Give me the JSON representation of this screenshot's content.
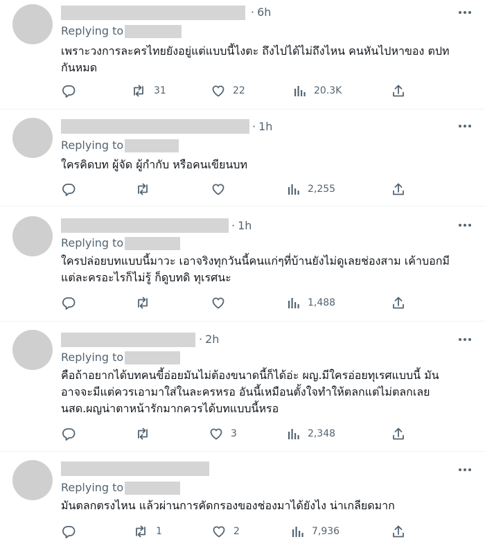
{
  "colors": {
    "meta_text": "#536471",
    "body_text": "#0f1419",
    "placeholder_gray": "#d5d5d5",
    "avatar_gray": "#cfcfcf",
    "divider": "#eff3f4"
  },
  "icons": {
    "reply": "comment-bubble-icon",
    "retweet": "retweet-arrows-icon",
    "like": "heart-icon",
    "views": "bar-chart-icon",
    "share": "upload-arrow-icon",
    "more": "more-dots-icon"
  },
  "tweets": [
    {
      "time": "6h",
      "replying_to": "Replying to",
      "text": "เพราะวงการละครไทยยังอยู่แต่แบบนี้ไงตะ ถึงไปได้ไม่ถึงไหน คนหันไปหาของ ตปท\nกันหมด",
      "replies": "",
      "retweets": "31",
      "likes": "22",
      "views": "20.3K"
    },
    {
      "time": "1h",
      "replying_to": "Replying to",
      "text": "ใครคิดบท ผู้จัด ผู้กำกับ หรือคนเขียนบท",
      "replies": "",
      "retweets": "",
      "likes": "",
      "views": "2,255"
    },
    {
      "time": "1h",
      "replying_to": "Replying to",
      "text": "ใครปล่อยบทแบบนี้มาวะ เอาจริงทุกวันนี้คนแก่ๆที่บ้านยังไม่ดูเลยช่องสาม เค้าบอกมี\nแต่ละครอะไรก็ไม่รู้ ก็ดูบทดิ ทุเรศนะ",
      "replies": "",
      "retweets": "",
      "likes": "",
      "views": "1,488"
    },
    {
      "time": "2h",
      "replying_to": "Replying to",
      "text": "คือถ้าอยากได้บทคนขี้อ่อยมันไม่ต้องขนาดนี้ก็ได้อ่ะ ผญ.มีใครอ่อยทุเรศแบบนี้ มัน\nอาจจะมีแต่ควรเอามาใส่ในละครหรอ อันนี้เหมือนตั้งใจทำให้ตลกแต่ไม่ตลกเลย\nนสด.ผญน่าตาหน้ารักมากควรได้บทแบบนี้หรอ",
      "replies": "",
      "retweets": "",
      "likes": "3",
      "views": "2,348"
    },
    {
      "time": "",
      "replying_to": "Replying to",
      "text": "มันตลกตรงไหน แล้วผ่านการคัดกรองของช่องมาได้ยังไง น่าเกลียดมาก",
      "replies": "",
      "retweets": "1",
      "likes": "2",
      "views": "7,936"
    }
  ]
}
